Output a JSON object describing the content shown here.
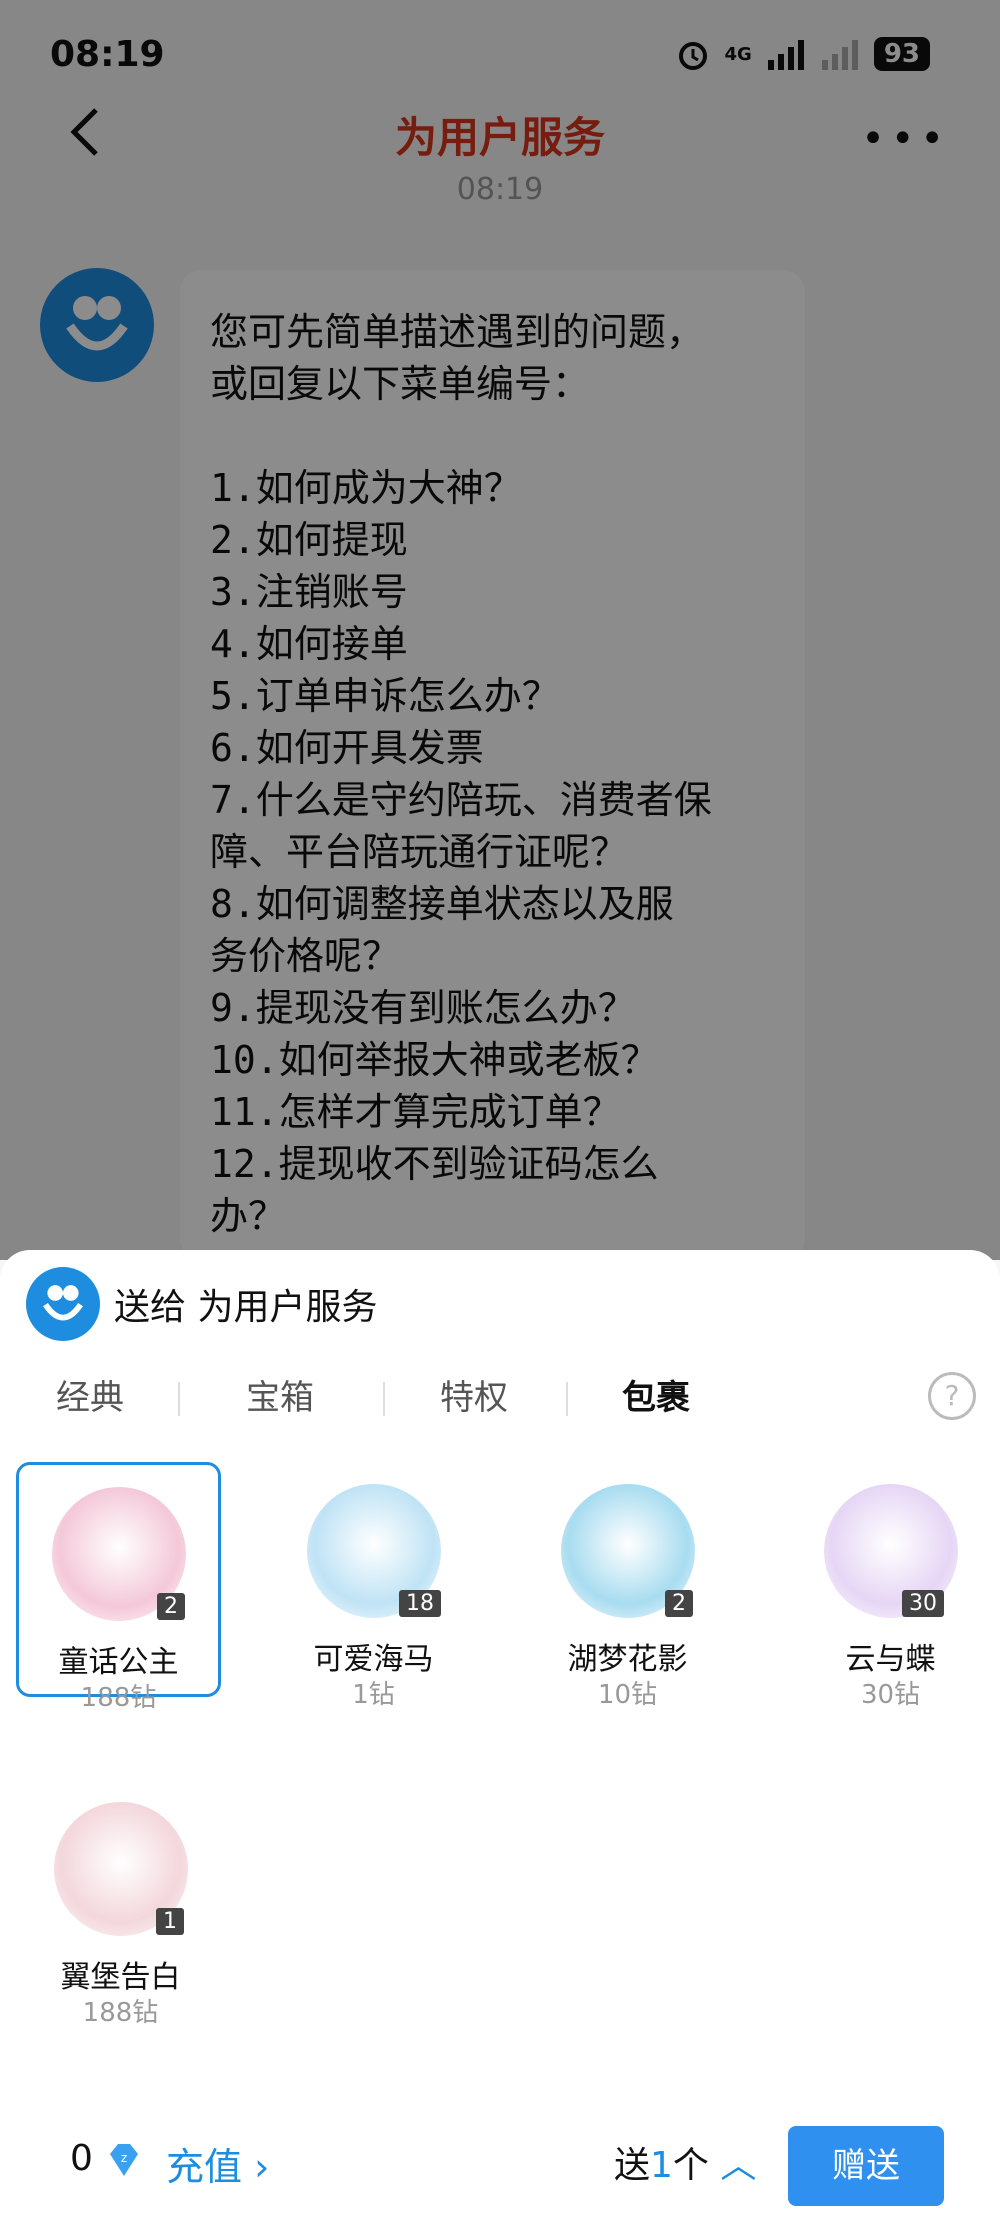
{
  "status": {
    "time": "08:19",
    "network": "4G",
    "battery": "93"
  },
  "header": {
    "title": "为用户服务"
  },
  "chat": {
    "timestamp": "08:19",
    "message": "您可先简单描述遇到的问题，\n或回复以下菜单编号：\n\n1.如何成为大神？\n2.如何提现\n3.注销账号\n4.如何接单\n5.订单申诉怎么办？\n6.如何开具发票\n7.什么是守约陪玩、消费者保\n障、平台陪玩通行证呢？\n8.如何调整接单状态以及服\n务价格呢？\n9.提现没有到账怎么办？\n10.如何举报大神或老板？\n11.怎样才算完成订单？\n12.提现收不到验证码怎么\n办？"
  },
  "sheet": {
    "title": "送给 为用户服务",
    "tabs": [
      {
        "label": "经典",
        "active": false
      },
      {
        "label": "宝箱",
        "active": false
      },
      {
        "label": "特权",
        "active": false
      },
      {
        "label": "包裹",
        "active": true
      }
    ],
    "gifts": [
      {
        "name": "童话公主",
        "price": "188钻",
        "count": "2",
        "selected": true,
        "color": "#f4c8d8"
      },
      {
        "name": "可爱海马",
        "price": "1钻",
        "count": "18",
        "selected": false,
        "color": "#bfe3f5"
      },
      {
        "name": "湖梦花影",
        "price": "10钻",
        "count": "2",
        "selected": false,
        "color": "#a8dcf0"
      },
      {
        "name": "云与蝶",
        "price": "30钻",
        "count": "30",
        "selected": false,
        "color": "#e6d6f5"
      },
      {
        "name": "翼堡告白",
        "price": "188钻",
        "count": "1",
        "selected": false,
        "color": "#f3d7dc"
      }
    ]
  },
  "bottom": {
    "balance": "0",
    "recharge_label": "充值",
    "send_prefix": "送",
    "quantity": "1",
    "send_unit": "个",
    "gift_button": "赠送"
  }
}
